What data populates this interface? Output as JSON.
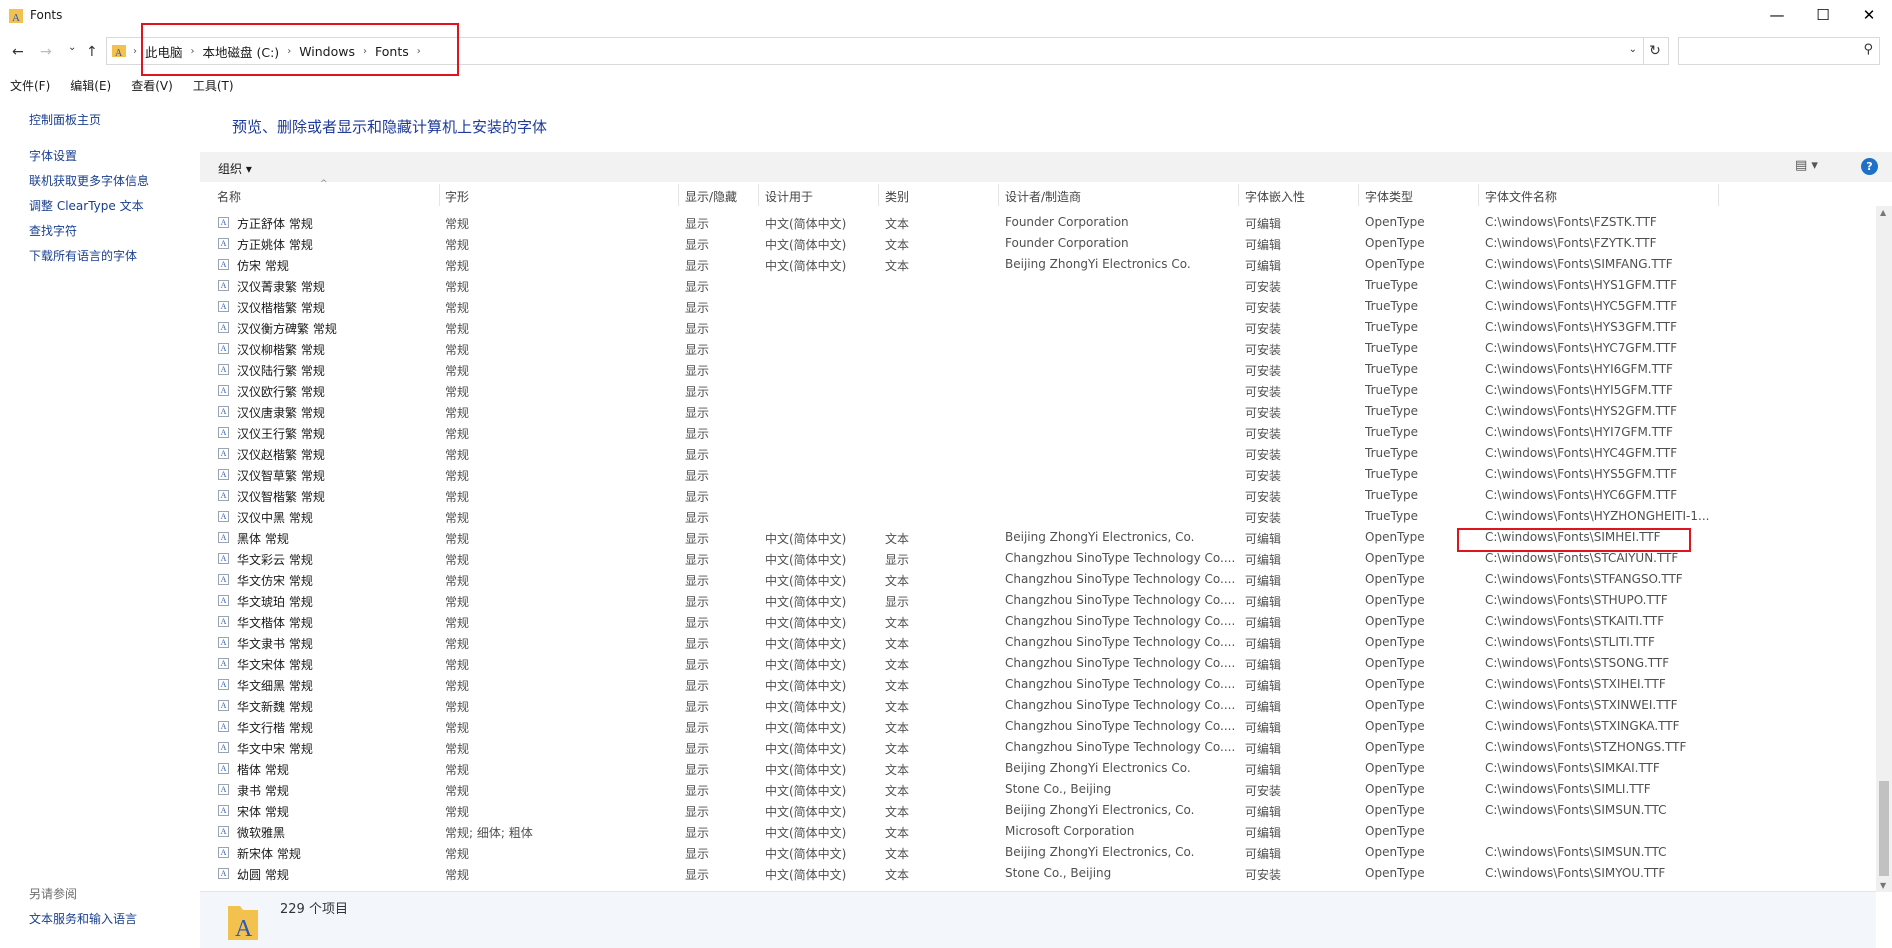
{
  "window": {
    "title": "Fonts",
    "minimize": "—",
    "maximize": "☐",
    "close": "✕"
  },
  "nav": {
    "back": "←",
    "forward": "→",
    "history": "⌄",
    "up": "↑"
  },
  "address": {
    "crumbs": [
      "此电脑",
      "本地磁盘 (C:)",
      "Windows",
      "Fonts"
    ],
    "separator": "›",
    "dropdown": "⌄",
    "refresh": "↻"
  },
  "search": {
    "placeholder": "",
    "icon": "⚲"
  },
  "menu": [
    "文件(F)",
    "编辑(E)",
    "查看(V)",
    "工具(T)"
  ],
  "left_pane": {
    "links": [
      "控制面板主页",
      "字体设置",
      "联机获取更多字体信息",
      "调整 ClearType 文本",
      "查找字符",
      "下载所有语言的字体"
    ],
    "see_also_label": "另请参阅",
    "see_also": [
      "文本服务和输入语言"
    ]
  },
  "heading": "预览、删除或者显示和隐藏计算机上安装的字体",
  "toolbar": {
    "organize": "组织 ▾",
    "view": "▤ ▾",
    "help": "?"
  },
  "columns": [
    "名称",
    "字形",
    "显示/隐藏",
    "设计用于",
    "类别",
    "设计者/制造商",
    "字体嵌入性",
    "字体类型",
    "字体文件名称"
  ],
  "rows": [
    [
      "方正舒体 常规",
      "常规",
      "显示",
      "中文(简体中文)",
      "文本",
      "Founder Corporation",
      "可编辑",
      "OpenType",
      "C:\\windows\\Fonts\\FZSTK.TTF"
    ],
    [
      "方正姚体 常规",
      "常规",
      "显示",
      "中文(简体中文)",
      "文本",
      "Founder Corporation",
      "可编辑",
      "OpenType",
      "C:\\windows\\Fonts\\FZYTK.TTF"
    ],
    [
      "仿宋 常规",
      "常规",
      "显示",
      "中文(简体中文)",
      "文本",
      "Beijing ZhongYi Electronics Co.",
      "可编辑",
      "OpenType",
      "C:\\windows\\Fonts\\SIMFANG.TTF"
    ],
    [
      "汉仪菁隶繁 常规",
      "常规",
      "显示",
      "",
      "",
      "",
      "可安装",
      "TrueType",
      "C:\\windows\\Fonts\\HYS1GFM.TTF"
    ],
    [
      "汉仪楷楷繁 常规",
      "常规",
      "显示",
      "",
      "",
      "",
      "可安装",
      "TrueType",
      "C:\\windows\\Fonts\\HYC5GFM.TTF"
    ],
    [
      "汉仪衡方碑繁 常规",
      "常规",
      "显示",
      "",
      "",
      "",
      "可安装",
      "TrueType",
      "C:\\windows\\Fonts\\HYS3GFM.TTF"
    ],
    [
      "汉仪柳楷繁 常规",
      "常规",
      "显示",
      "",
      "",
      "",
      "可安装",
      "TrueType",
      "C:\\windows\\Fonts\\HYC7GFM.TTF"
    ],
    [
      "汉仪陆行繁 常规",
      "常规",
      "显示",
      "",
      "",
      "",
      "可安装",
      "TrueType",
      "C:\\windows\\Fonts\\HYI6GFM.TTF"
    ],
    [
      "汉仪欧行繁 常规",
      "常规",
      "显示",
      "",
      "",
      "",
      "可安装",
      "TrueType",
      "C:\\windows\\Fonts\\HYI5GFM.TTF"
    ],
    [
      "汉仪唐隶繁 常规",
      "常规",
      "显示",
      "",
      "",
      "",
      "可安装",
      "TrueType",
      "C:\\windows\\Fonts\\HYS2GFM.TTF"
    ],
    [
      "汉仪王行繁 常规",
      "常规",
      "显示",
      "",
      "",
      "",
      "可安装",
      "TrueType",
      "C:\\windows\\Fonts\\HYI7GFM.TTF"
    ],
    [
      "汉仪赵楷繁 常规",
      "常规",
      "显示",
      "",
      "",
      "",
      "可安装",
      "TrueType",
      "C:\\windows\\Fonts\\HYC4GFM.TTF"
    ],
    [
      "汉仪智草繁 常规",
      "常规",
      "显示",
      "",
      "",
      "",
      "可安装",
      "TrueType",
      "C:\\windows\\Fonts\\HYS5GFM.TTF"
    ],
    [
      "汉仪智楷繁 常规",
      "常规",
      "显示",
      "",
      "",
      "",
      "可安装",
      "TrueType",
      "C:\\windows\\Fonts\\HYC6GFM.TTF"
    ],
    [
      "汉仪中黑 常规",
      "常规",
      "显示",
      "",
      "",
      "",
      "可安装",
      "TrueType",
      "C:\\windows\\Fonts\\HYZHONGHEITI-1..."
    ],
    [
      "黑体 常规",
      "常规",
      "显示",
      "中文(简体中文)",
      "文本",
      "Beijing ZhongYi Electronics, Co.",
      "可编辑",
      "OpenType",
      "C:\\windows\\Fonts\\SIMHEI.TTF"
    ],
    [
      "华文彩云 常规",
      "常规",
      "显示",
      "中文(简体中文)",
      "显示",
      "Changzhou SinoType Technology Co....",
      "可编辑",
      "OpenType",
      "C:\\windows\\Fonts\\STCAIYUN.TTF"
    ],
    [
      "华文仿宋 常规",
      "常规",
      "显示",
      "中文(简体中文)",
      "文本",
      "Changzhou SinoType Technology Co....",
      "可编辑",
      "OpenType",
      "C:\\windows\\Fonts\\STFANGSO.TTF"
    ],
    [
      "华文琥珀 常规",
      "常规",
      "显示",
      "中文(简体中文)",
      "显示",
      "Changzhou SinoType Technology Co....",
      "可编辑",
      "OpenType",
      "C:\\windows\\Fonts\\STHUPO.TTF"
    ],
    [
      "华文楷体 常规",
      "常规",
      "显示",
      "中文(简体中文)",
      "文本",
      "Changzhou SinoType Technology Co....",
      "可编辑",
      "OpenType",
      "C:\\windows\\Fonts\\STKAITI.TTF"
    ],
    [
      "华文隶书 常规",
      "常规",
      "显示",
      "中文(简体中文)",
      "文本",
      "Changzhou SinoType Technology Co....",
      "可编辑",
      "OpenType",
      "C:\\windows\\Fonts\\STLITI.TTF"
    ],
    [
      "华文宋体 常规",
      "常规",
      "显示",
      "中文(简体中文)",
      "文本",
      "Changzhou SinoType Technology Co....",
      "可编辑",
      "OpenType",
      "C:\\windows\\Fonts\\STSONG.TTF"
    ],
    [
      "华文细黑 常规",
      "常规",
      "显示",
      "中文(简体中文)",
      "文本",
      "Changzhou SinoType Technology Co....",
      "可编辑",
      "OpenType",
      "C:\\windows\\Fonts\\STXIHEI.TTF"
    ],
    [
      "华文新魏 常规",
      "常规",
      "显示",
      "中文(简体中文)",
      "文本",
      "Changzhou SinoType Technology Co....",
      "可编辑",
      "OpenType",
      "C:\\windows\\Fonts\\STXINWEI.TTF"
    ],
    [
      "华文行楷 常规",
      "常规",
      "显示",
      "中文(简体中文)",
      "文本",
      "Changzhou SinoType Technology Co....",
      "可编辑",
      "OpenType",
      "C:\\windows\\Fonts\\STXINGKA.TTF"
    ],
    [
      "华文中宋 常规",
      "常规",
      "显示",
      "中文(简体中文)",
      "文本",
      "Changzhou SinoType Technology Co....",
      "可编辑",
      "OpenType",
      "C:\\windows\\Fonts\\STZHONGS.TTF"
    ],
    [
      "楷体 常规",
      "常规",
      "显示",
      "中文(简体中文)",
      "文本",
      "Beijing ZhongYi Electronics Co.",
      "可编辑",
      "OpenType",
      "C:\\windows\\Fonts\\SIMKAI.TTF"
    ],
    [
      "隶书 常规",
      "常规",
      "显示",
      "中文(简体中文)",
      "文本",
      "Stone Co., Beijing",
      "可安装",
      "OpenType",
      "C:\\windows\\Fonts\\SIMLI.TTF"
    ],
    [
      "宋体 常规",
      "常规",
      "显示",
      "中文(简体中文)",
      "文本",
      "Beijing ZhongYi Electronics, Co.",
      "可编辑",
      "OpenType",
      "C:\\windows\\Fonts\\SIMSUN.TTC"
    ],
    [
      "微软雅黑",
      "常规; 细体; 粗体",
      "显示",
      "中文(简体中文)",
      "文本",
      "Microsoft Corporation",
      "可编辑",
      "OpenType",
      ""
    ],
    [
      "新宋体 常规",
      "常规",
      "显示",
      "中文(简体中文)",
      "文本",
      "Beijing ZhongYi Electronics, Co.",
      "可编辑",
      "OpenType",
      "C:\\windows\\Fonts\\SIMSUN.TTC"
    ],
    [
      "幼圆 常规",
      "常规",
      "显示",
      "中文(简体中文)",
      "文本",
      "Stone Co., Beijing",
      "可安装",
      "OpenType",
      "C:\\windows\\Fonts\\SIMYOU.TTF"
    ]
  ],
  "status": {
    "count": "229 个项目"
  },
  "colors": {
    "highlight": "#e0141e",
    "link": "#1a3f8f",
    "heading": "#1e3a9b",
    "folder": "#f2c14e",
    "font_letter": "#2a58b8"
  }
}
